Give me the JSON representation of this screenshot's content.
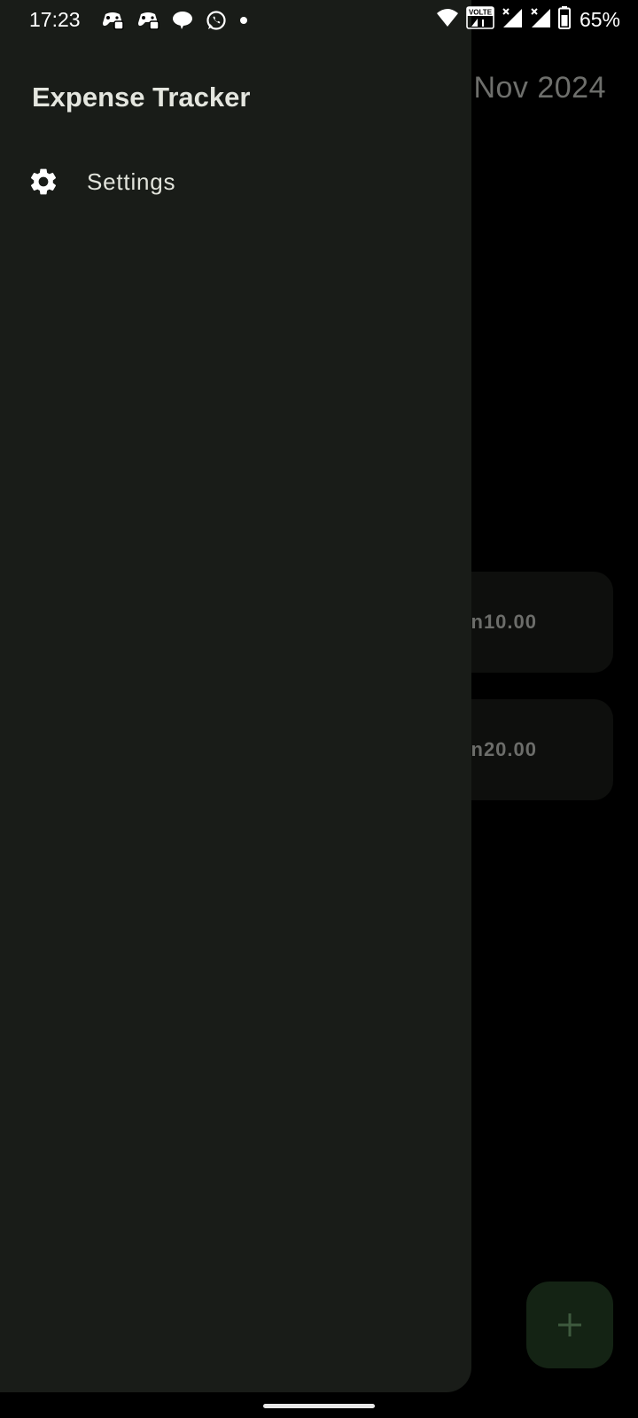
{
  "status_bar": {
    "time": "17:23",
    "notification_icons": [
      "game-controller-icon",
      "game-controller-icon",
      "chat-bubble-icon",
      "whatsapp-icon",
      "dot-icon"
    ],
    "volte_label": "VOLTE",
    "battery_percent": "65%",
    "system_icons": [
      "wifi-icon",
      "volte-icon",
      "signal-icon",
      "signal-icon",
      "battery-icon"
    ]
  },
  "drawer": {
    "title": "Expense Tracker",
    "items": [
      {
        "label": "Settings",
        "icon": "gear-icon"
      }
    ]
  },
  "main": {
    "month_title": "Nov 2024",
    "expenses": [
      {
        "amount": "n10.00"
      },
      {
        "amount": "n20.00"
      }
    ],
    "fab_icon": "plus-icon"
  },
  "colors": {
    "drawer_background": "#191c18",
    "scrim": "#000000",
    "fab_background": "#142314"
  }
}
